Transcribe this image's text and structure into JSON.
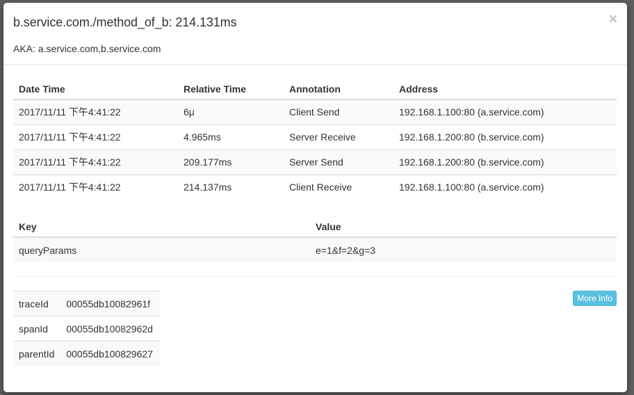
{
  "modal": {
    "title": "b.service.com./method_of_b: 214.131ms",
    "aka": "AKA: a.service.com,b.service.com",
    "close_glyph": "×"
  },
  "annotations": {
    "headers": [
      "Date Time",
      "Relative Time",
      "Annotation",
      "Address"
    ],
    "rows": [
      [
        "2017/11/11 下午4:41:22",
        "6μ",
        "Client Send",
        "192.168.1.100:80 (a.service.com)"
      ],
      [
        "2017/11/11 下午4:41:22",
        "4.965ms",
        "Server Receive",
        "192.168.1.200:80 (b.service.com)"
      ],
      [
        "2017/11/11 下午4:41:22",
        "209.177ms",
        "Server Send",
        "192.168.1.200:80 (b.service.com)"
      ],
      [
        "2017/11/11 下午4:41:22",
        "214.137ms",
        "Client Receive",
        "192.168.1.100:80 (a.service.com)"
      ]
    ]
  },
  "binary_annotations": {
    "headers": [
      "Key",
      "Value"
    ],
    "rows": [
      [
        "queryParams",
        "e=1&f=2&g=3"
      ]
    ]
  },
  "more_info_label": "More Info",
  "ids": [
    [
      "traceId",
      "00055db10082961f"
    ],
    [
      "spanId",
      "00055db10082962d"
    ],
    [
      "parentId",
      "00055db100829627"
    ]
  ],
  "colors": {
    "info_button": "#5bc0de",
    "stripe": "#f9f9f9"
  }
}
